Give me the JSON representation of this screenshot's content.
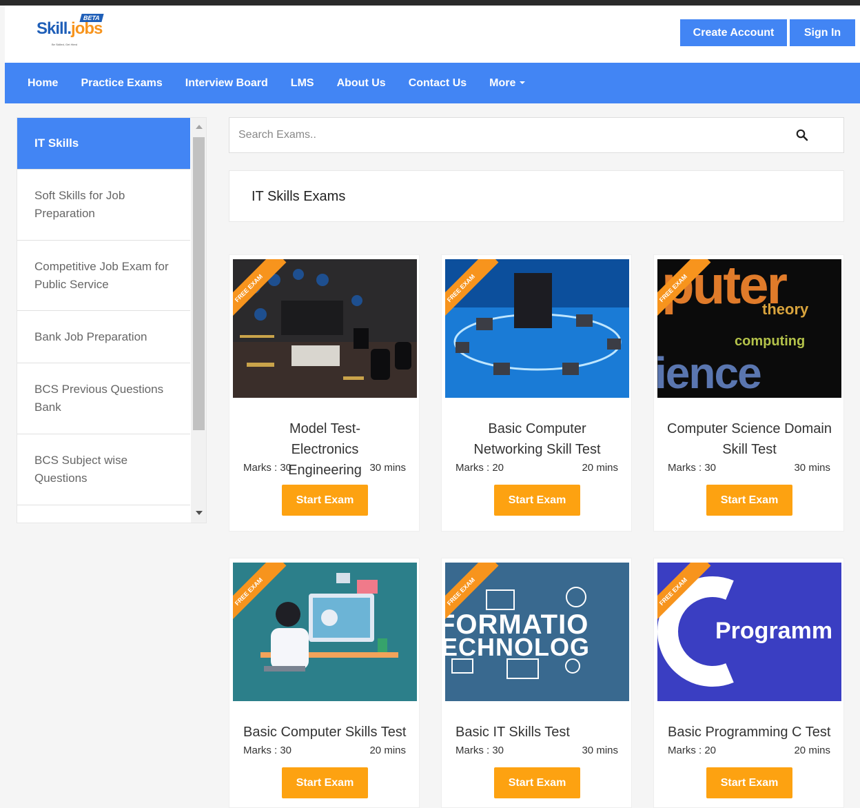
{
  "logo": {
    "text_main": "Skill",
    "text_accent": "jobs",
    "beta": "BETA",
    "tagline": "Be Skilled, Get Hired"
  },
  "header": {
    "create_account": "Create Account",
    "sign_in": "Sign In"
  },
  "nav": {
    "items": [
      "Home",
      "Practice Exams",
      "Interview Board",
      "LMS",
      "About Us",
      "Contact Us"
    ],
    "more": "More"
  },
  "sidebar": {
    "items": [
      "IT Skills",
      "Soft Skills for Job Preparation",
      "Competitive Job Exam for Public Service",
      "Bank Job Preparation",
      "BCS Previous Questions Bank",
      "BCS Subject wise Questions"
    ]
  },
  "search": {
    "placeholder": "Search Exams.."
  },
  "section_title": "IT Skills Exams",
  "ribbon_label": "FREE EXAM",
  "start_label": "Start Exam",
  "cards": [
    {
      "title": "Model Test-Electronics Engineering",
      "marks": "Marks : 30",
      "time": "30 mins"
    },
    {
      "title": "Basic Computer Networking Skill Test",
      "marks": "Marks : 20",
      "time": "20 mins"
    },
    {
      "title": "Computer Science Domain Skill Test",
      "marks": "Marks : 30",
      "time": "30 mins",
      "img_text_1": "puter",
      "img_text_2": "theory",
      "img_text_3": "computing",
      "img_text_4": "ience"
    },
    {
      "title": "Basic Computer Skills Test",
      "marks": "Marks : 30",
      "time": "20 mins"
    },
    {
      "title": "Basic IT Skills Test",
      "marks": "Marks : 30",
      "time": "30 mins",
      "img_text_1": "FORMATIO",
      "img_text_2": "ECHNOLOG"
    },
    {
      "title": "Basic Programming C Test",
      "marks": "Marks : 20",
      "time": "20 mins",
      "img_text_1": "Programm"
    }
  ],
  "colors": {
    "primary": "#4285f4",
    "accent": "#fda211",
    "ribbon": "#f7941d"
  }
}
